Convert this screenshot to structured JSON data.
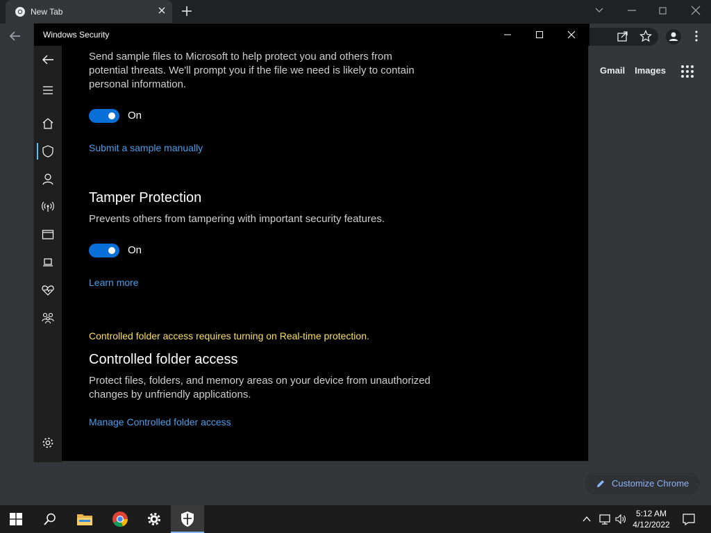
{
  "chrome": {
    "tab_title": "New Tab",
    "ntp_links": [
      "Gmail",
      "Images"
    ],
    "customize_label": "Customize Chrome"
  },
  "window": {
    "title": "Windows Security",
    "nav_icons": [
      "back-icon",
      "hamburger-menu-icon",
      "home-icon",
      "shield-icon",
      "account-icon",
      "network-icon",
      "app-browser-icon",
      "device-icon",
      "health-icon",
      "family-icon",
      "settings-icon"
    ]
  },
  "content": {
    "sample_desc": [
      "Send sample files to Microsoft to help protect you and others from",
      "potential threats. We'll prompt you if the file we need is likely to contain",
      "personal information."
    ],
    "sample_toggle_label": "On",
    "submit_link": "Submit a sample manually",
    "tamper_heading": "Tamper Protection",
    "tamper_desc": "Prevents others from tampering with important security features.",
    "tamper_toggle_label": "On",
    "learn_more_link": "Learn more",
    "cfa_warning": "Controlled folder access requires turning on Real-time protection.",
    "cfa_heading": "Controlled folder access",
    "cfa_desc": [
      "Protect files, folders, and memory areas on your device from unauthorized",
      "changes by unfriendly applications."
    ],
    "cfa_link": "Manage Controlled folder access"
  },
  "taskbar": {
    "time": "5:12 AM",
    "date": "4/12/2022",
    "icons": [
      "windows-start-icon",
      "search-icon",
      "file-explorer-icon",
      "chrome-icon",
      "settings-icon",
      "windows-security-icon"
    ]
  },
  "colors": {
    "accent_blue": "#0a6fd6",
    "link_blue": "#4a9ee9",
    "warning_yellow": "#fcdf5f"
  }
}
